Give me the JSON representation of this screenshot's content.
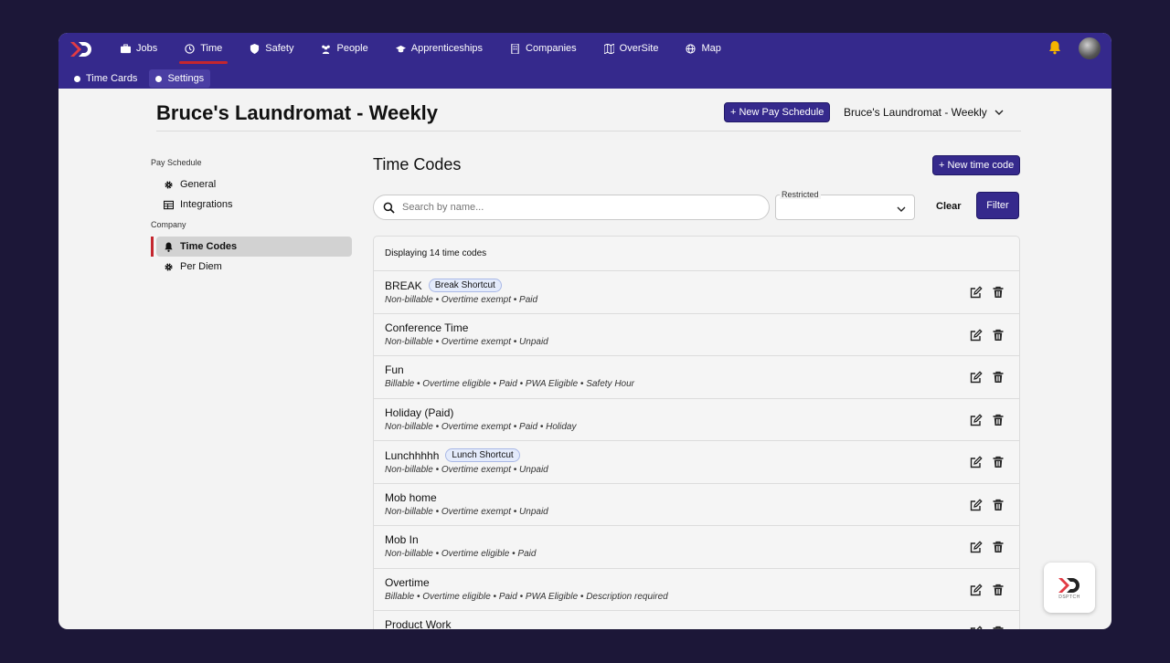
{
  "nav": {
    "items": [
      {
        "label": "Jobs",
        "icon": "briefcase-icon"
      },
      {
        "label": "Time",
        "icon": "clock-icon"
      },
      {
        "label": "Safety",
        "icon": "shield-icon"
      },
      {
        "label": "People",
        "icon": "people-icon"
      },
      {
        "label": "Apprenticeships",
        "icon": "graduation-cap-icon"
      },
      {
        "label": "Companies",
        "icon": "building-icon"
      },
      {
        "label": "OverSite",
        "icon": "map-fold-icon"
      },
      {
        "label": "Map",
        "icon": "globe-icon"
      }
    ],
    "active": "Time"
  },
  "subnav": {
    "items": [
      "Time Cards",
      "Settings"
    ],
    "active": "Settings"
  },
  "page": {
    "title": "Bruce's Laundromat - Weekly",
    "new_pay_schedule": "+ New Pay Schedule",
    "schedule_select": "Bruce's Laundromat - Weekly"
  },
  "sidebar": {
    "sections": [
      {
        "title": "Pay Schedule",
        "items": [
          {
            "label": "General",
            "icon": "gear-icon"
          },
          {
            "label": "Integrations",
            "icon": "table-icon"
          }
        ]
      },
      {
        "title": "Company",
        "items": [
          {
            "label": "Time Codes",
            "icon": "bell-icon"
          },
          {
            "label": "Per Diem",
            "icon": "gear-icon"
          }
        ]
      }
    ],
    "active": "Time Codes"
  },
  "main": {
    "title": "Time Codes",
    "new_time_code": "+ New time code",
    "search_placeholder": "Search by name...",
    "restricted_label": "Restricted",
    "clear": "Clear",
    "filter": "Filter",
    "count_text": "Displaying 14 time codes",
    "rows": [
      {
        "name": "BREAK",
        "badge": "Break Shortcut",
        "meta": "Non-billable • Overtime exempt • Paid"
      },
      {
        "name": "Conference Time",
        "badge": "",
        "meta": "Non-billable • Overtime exempt • Unpaid"
      },
      {
        "name": "Fun",
        "badge": "",
        "meta": "Billable • Overtime eligible • Paid • PWA Eligible • Safety Hour"
      },
      {
        "name": "Holiday (Paid)",
        "badge": "",
        "meta": "Non-billable • Overtime exempt • Paid • Holiday"
      },
      {
        "name": "Lunchhhhh",
        "badge": "Lunch Shortcut",
        "meta": "Non-billable • Overtime exempt • Unpaid"
      },
      {
        "name": "Mob home",
        "badge": "",
        "meta": "Non-billable • Overtime exempt • Unpaid"
      },
      {
        "name": "Mob In",
        "badge": "",
        "meta": "Non-billable • Overtime eligible • Paid"
      },
      {
        "name": "Overtime",
        "badge": "",
        "meta": "Billable • Overtime eligible • Paid • PWA Eligible • Description required"
      },
      {
        "name": "Product Work",
        "badge": "",
        "meta": ""
      }
    ]
  },
  "widget": {
    "label": "DSPTCH"
  },
  "colors": {
    "brand": "#35298c",
    "accent": "#c4262e",
    "background": "#1c1738"
  }
}
